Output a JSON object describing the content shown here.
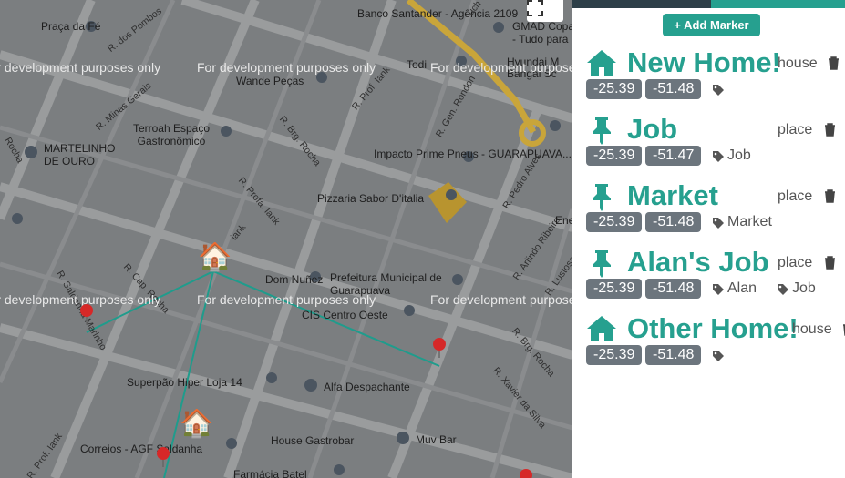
{
  "map": {
    "dev_notice": "For development purposes only",
    "places": {
      "praca_fe": "Praça da Fé",
      "r_dos_pombos": "R. dos Pombos",
      "banco": "Banco Santander - Agência 2109",
      "gmad": "GMAD Copa",
      "gmad_sub": "- Tudo para",
      "hyundai": "Hyundai M",
      "bangai": "Bangai Sc",
      "wande": "Wande Peças",
      "minas": "R. Minas Gerais",
      "terroah": "Terroah Espaço Gastronômico",
      "brg_rocha": "R. Brg. Rocha",
      "prof_iank": "R. Prof. Iank",
      "gen_rondon": "R. Gen. Rondon",
      "impacto": "Impacto Prime Pneus - GUARAPUAVA...",
      "martelinho": "MARTELINHO DE OURO",
      "profa_iank": "R. Profa. Iank",
      "pizzaria": "Pizzaria Sabor D'italia",
      "pedro_alves": "R. Pedro Alves",
      "cap_rocha": "R. Cap. Rocha",
      "dom_nunez": "Dom Nuñez",
      "prefeitura": "Prefeitura Municipal de Guarapuava",
      "cis": "CIS Centro Oeste",
      "saldanha_marinho": "R. Saldanha Marinho",
      "arlindo": "R. Arlindo Ribeiro",
      "lustosa": "R. Lustosa",
      "brg_rocha2": "R. Brg. Rocha",
      "xavier": "R. Xavier da Silva",
      "superpao": "Superpão Hiper Loja 14",
      "alfa": "Alfa Despachante",
      "house_gastrobar": "House Gastrobar",
      "muv_bar": "Muv Bar",
      "correios": "Correios - AGF Saldanha",
      "prof_iank3": "R. Prof. Iank",
      "farmacia": "Farmácia Batel",
      "todi": "Todi",
      "ene": "Ene",
      "rocha": "Rocha",
      "iank_small": "iank",
      "uch": "uch"
    }
  },
  "panel": {
    "add_button": "+ Add Marker",
    "markers": [
      {
        "name": "New Home!",
        "type": "house",
        "icon": "home-icon",
        "lat": "-25.39",
        "lng": "-51.48",
        "tags": []
      },
      {
        "name": "Job",
        "type": "place",
        "icon": "pushpin-icon",
        "lat": "-25.39",
        "lng": "-51.47",
        "tags": [
          "Job"
        ]
      },
      {
        "name": "Market",
        "type": "place",
        "icon": "pushpin-icon",
        "lat": "-25.39",
        "lng": "-51.48",
        "tags": [
          "Market"
        ]
      },
      {
        "name": "Alan's Job",
        "type": "place",
        "icon": "pushpin-icon",
        "lat": "-25.39",
        "lng": "-51.48",
        "tags": [
          "Alan",
          "Job"
        ]
      },
      {
        "name": "Other Home!",
        "type": "house",
        "icon": "home-icon",
        "lat": "-25.39",
        "lng": "-51.48",
        "tags": []
      }
    ]
  },
  "colors": {
    "accent": "#26a08f",
    "dark_tab": "#2d3f48",
    "badge": "#6c757d",
    "map_overlay": "#7b7e80"
  }
}
